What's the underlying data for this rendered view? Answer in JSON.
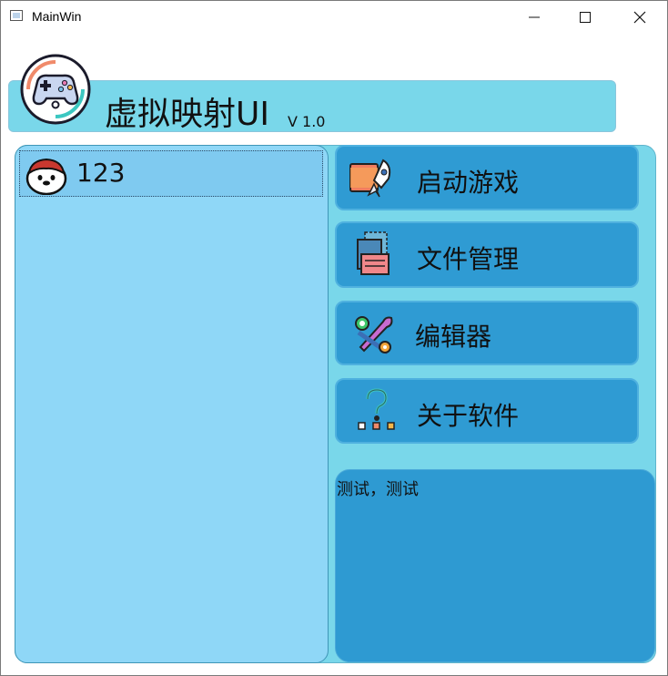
{
  "window": {
    "title": "MainWin",
    "controls": [
      "minimize-icon",
      "maximize-icon",
      "close-icon"
    ]
  },
  "header": {
    "logo_icon": "gamepad-logo-icon",
    "title": "虚拟映射UI",
    "version": "V 1.0"
  },
  "game_list": {
    "items": [
      {
        "avatar_icon": "penguin-avatar-icon",
        "label": "123"
      }
    ]
  },
  "menu": {
    "items": [
      {
        "icon": "rocket-folder-icon",
        "label": "启动游戏"
      },
      {
        "icon": "documents-icon",
        "label": "文件管理"
      },
      {
        "icon": "wrench-tools-icon",
        "label": "编辑器"
      },
      {
        "icon": "question-icon",
        "label": "关于软件"
      }
    ]
  },
  "info": {
    "text": "测试，测试"
  },
  "colors": {
    "header_bg": "#79d7ea",
    "panel_bg": "#79d7ea",
    "list_bg": "#8fd7f7",
    "button_bg": "#2f9bd3",
    "info_bg": "#2e9ad2"
  }
}
